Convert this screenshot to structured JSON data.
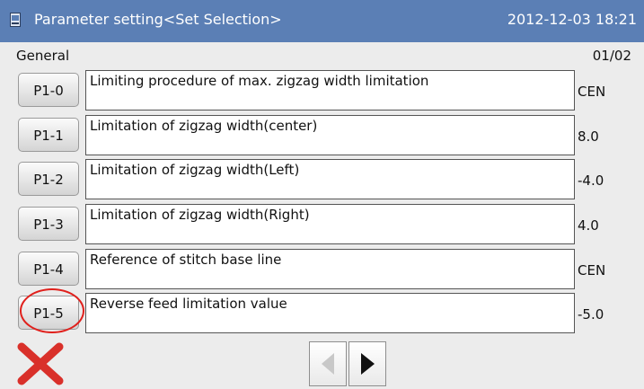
{
  "titlebar": {
    "title": "Parameter setting<Set Selection>",
    "datetime": "2012-12-03  18:21"
  },
  "header": {
    "group": "General",
    "page": "01/02"
  },
  "params": [
    {
      "code": "P1-0",
      "description": "Limiting procedure of max. zigzag width limitation",
      "value": "CEN"
    },
    {
      "code": "P1-1",
      "description": "Limitation of zigzag width(center)",
      "value": "8.0"
    },
    {
      "code": "P1-2",
      "description": "Limitation of zigzag width(Left)",
      "value": "-4.0"
    },
    {
      "code": "P1-3",
      "description": "Limitation of zigzag width(Right)",
      "value": "4.0"
    },
    {
      "code": "P1-4",
      "description": "Reference of stitch base line",
      "value": "CEN"
    },
    {
      "code": "P1-5",
      "description": "Reverse feed limitation value",
      "value": "-5.0"
    }
  ],
  "colors": {
    "titlebar": "#5b7fb5",
    "highlight": "#e0201c",
    "close": "#d9302a",
    "prev_disabled": "#c8c8c8",
    "next": "#111111"
  },
  "icons": {
    "title": "document-icon",
    "close": "close-icon",
    "prev": "arrow-left-icon",
    "next": "arrow-right-icon"
  }
}
